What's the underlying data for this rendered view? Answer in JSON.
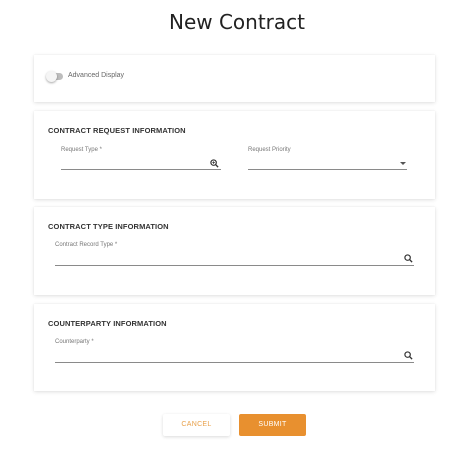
{
  "page": {
    "title": "New Contract"
  },
  "display_card": {
    "toggle_label": "Advanced Display",
    "toggle_on": false
  },
  "request_section": {
    "title": "CONTRACT REQUEST INFORMATION",
    "request_type_label": "Request Type *",
    "request_type_value": "",
    "request_priority_label": "Request Priority",
    "request_priority_value": ""
  },
  "type_section": {
    "title": "CONTRACT TYPE INFORMATION",
    "record_type_label": "Contract Record Type *",
    "record_type_value": ""
  },
  "counterparty_section": {
    "title": "COUNTERPARTY INFORMATION",
    "counterparty_label": "Counterparty *",
    "counterparty_value": ""
  },
  "actions": {
    "cancel_label": "CANCEL",
    "submit_label": "SUBMIT"
  },
  "icons": {
    "request_type": "zoom-search-icon",
    "priority": "dropdown-caret-icon",
    "record_type": "search-icon",
    "counterparty": "search-icon"
  },
  "colors": {
    "accent": "#e8902f",
    "cancel_text": "#e8a04a"
  }
}
